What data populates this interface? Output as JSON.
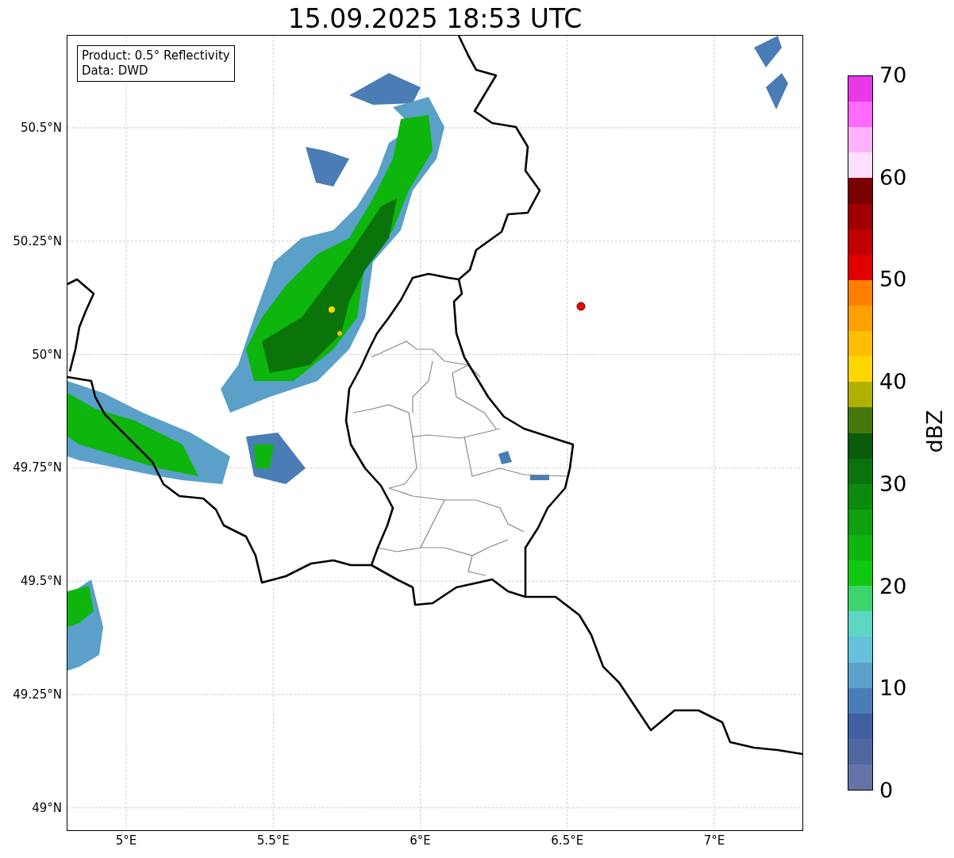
{
  "title": "15.09.2025 18:53 UTC",
  "info_box": [
    "Product: 0.5° Reflectivity",
    "Data: DWD"
  ],
  "map": {
    "x_ticks": [
      "5°E",
      "5.5°E",
      "6°E",
      "6.5°E",
      "7°E"
    ],
    "y_ticks": [
      "50.5°N",
      "50.25°N",
      "50°N",
      "49.75°N",
      "49.5°N",
      "49.25°N",
      "49°N"
    ]
  },
  "colorbar": {
    "label": "dBZ",
    "ticks": [
      "70",
      "60",
      "50",
      "40",
      "30",
      "20",
      "10",
      "0"
    ],
    "bands": [
      {
        "color": "#e838e8"
      },
      {
        "color": "#ff6aff"
      },
      {
        "color": "#ffb3ff"
      },
      {
        "color": "#ffdfff"
      },
      {
        "color": "#7a0000"
      },
      {
        "color": "#a00000"
      },
      {
        "color": "#c00000"
      },
      {
        "color": "#e00000"
      },
      {
        "color": "#ff7f00"
      },
      {
        "color": "#ff9f00"
      },
      {
        "color": "#ffbf00"
      },
      {
        "color": "#ffd700"
      },
      {
        "color": "#b0b000"
      },
      {
        "color": "#45770a"
      },
      {
        "color": "#0a5c0a"
      },
      {
        "color": "#0a730a"
      },
      {
        "color": "#0b8a0b"
      },
      {
        "color": "#0ea00e"
      },
      {
        "color": "#0db50d"
      },
      {
        "color": "#11c811"
      },
      {
        "color": "#3cd46c"
      },
      {
        "color": "#5ed6c4"
      },
      {
        "color": "#66c2db"
      },
      {
        "color": "#5aa0c8"
      },
      {
        "color": "#4a7db5"
      },
      {
        "color": "#4060a0"
      },
      {
        "color": "#5068a0"
      },
      {
        "color": "#6474a8"
      }
    ]
  }
}
